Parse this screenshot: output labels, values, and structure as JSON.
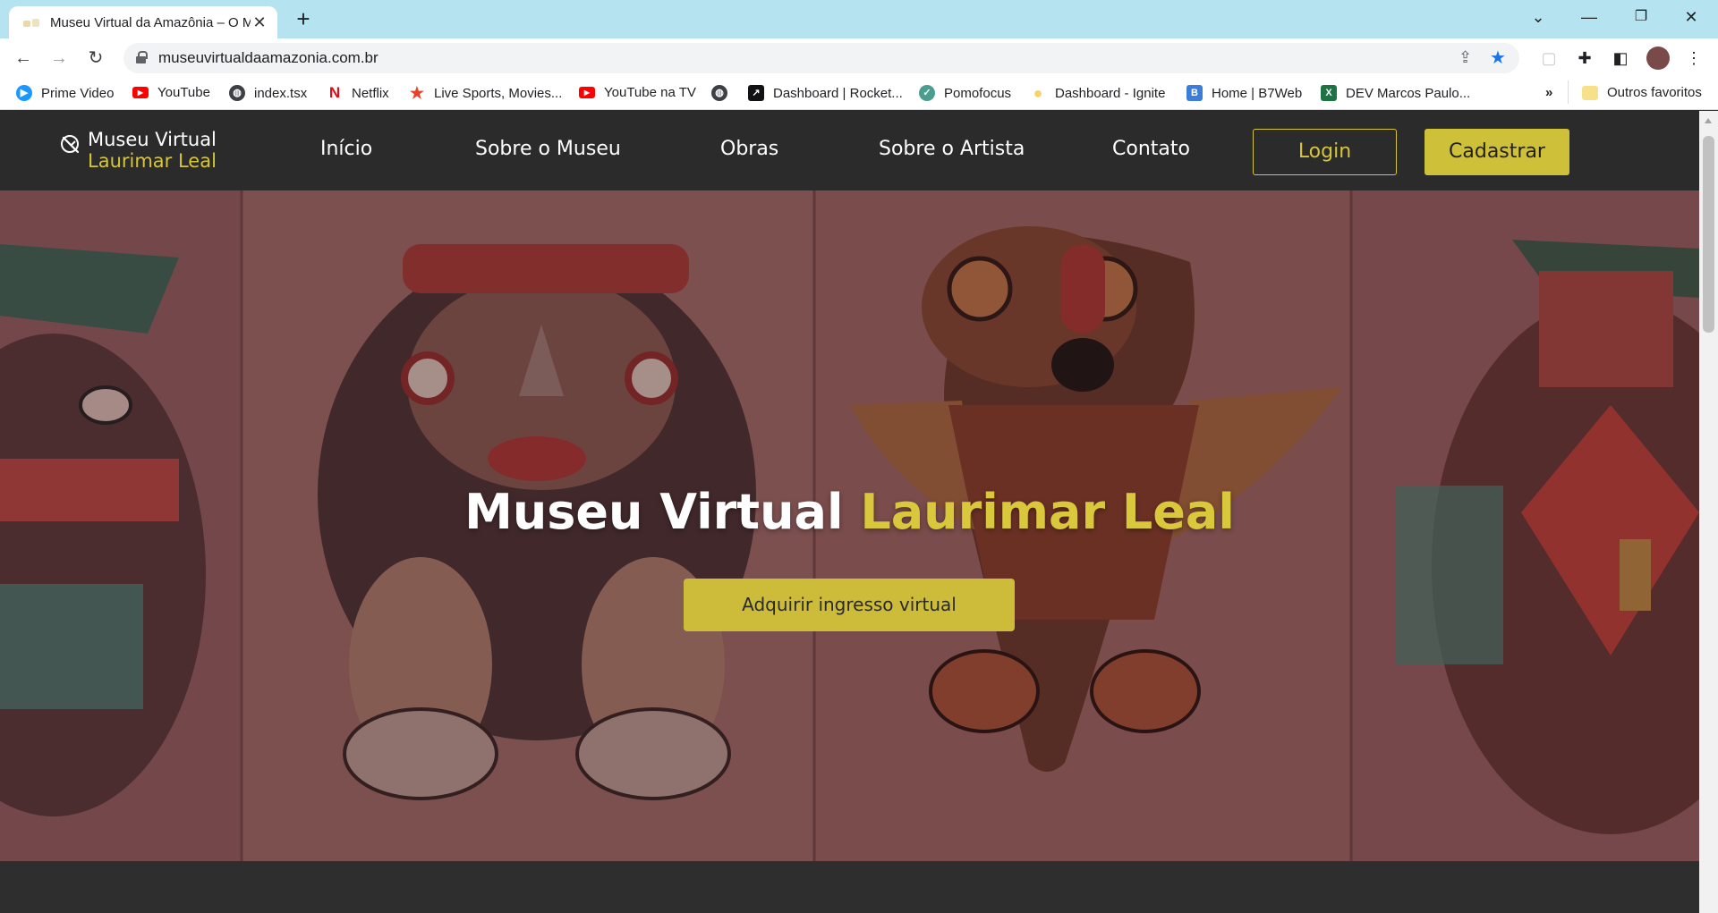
{
  "browser": {
    "tab_title": "Museu Virtual da Amazônia – O M",
    "url": "museuvirtualdaamazonia.com.br",
    "bookmarks": [
      {
        "label": "Prime Video",
        "icon": "prime-video-icon",
        "color": "#1a98ff"
      },
      {
        "label": "YouTube",
        "icon": "youtube-icon",
        "color": "#ff0000"
      },
      {
        "label": "index.tsx",
        "icon": "globe-icon",
        "color": "#3c4043"
      },
      {
        "label": "Netflix",
        "icon": "netflix-icon",
        "color": "#e50914"
      },
      {
        "label": "Live Sports, Movies...",
        "icon": "star-icon",
        "color": "#e8432a"
      },
      {
        "label": "YouTube na TV",
        "icon": "youtube-icon",
        "color": "#ff0000"
      },
      {
        "label": "",
        "icon": "globe-icon",
        "color": "#3c4043"
      },
      {
        "label": "Dashboard | Rocket...",
        "icon": "rocketseat-icon",
        "color": "#121214"
      },
      {
        "label": "Pomofocus",
        "icon": "check-icon",
        "color": "#4a9d8f"
      },
      {
        "label": "Dashboard - Ignite",
        "icon": "lightbulb-icon",
        "color": "#f7d26a"
      },
      {
        "label": "Home | B7Web",
        "icon": "b7web-icon",
        "color": "#3b7dd8"
      },
      {
        "label": "DEV Marcos Paulo...",
        "icon": "excel-icon",
        "color": "#1f7244"
      }
    ],
    "other_bookmarks": "Outros favoritos",
    "overflow": "»"
  },
  "site": {
    "logo_line1": "Museu Virtual",
    "logo_line2": "Laurimar Leal",
    "nav": [
      "Início",
      "Sobre o Museu",
      "Obras",
      "Sobre o Artista",
      "Contato"
    ],
    "login": "Login",
    "signup": "Cadastrar",
    "hero_title_white": "Museu Virtual",
    "hero_title_gold": "Laurimar Leal",
    "hero_cta": "Adquirir ingresso virtual",
    "accent": "#d6c53a",
    "nav_bg": "#2b2b2b"
  }
}
